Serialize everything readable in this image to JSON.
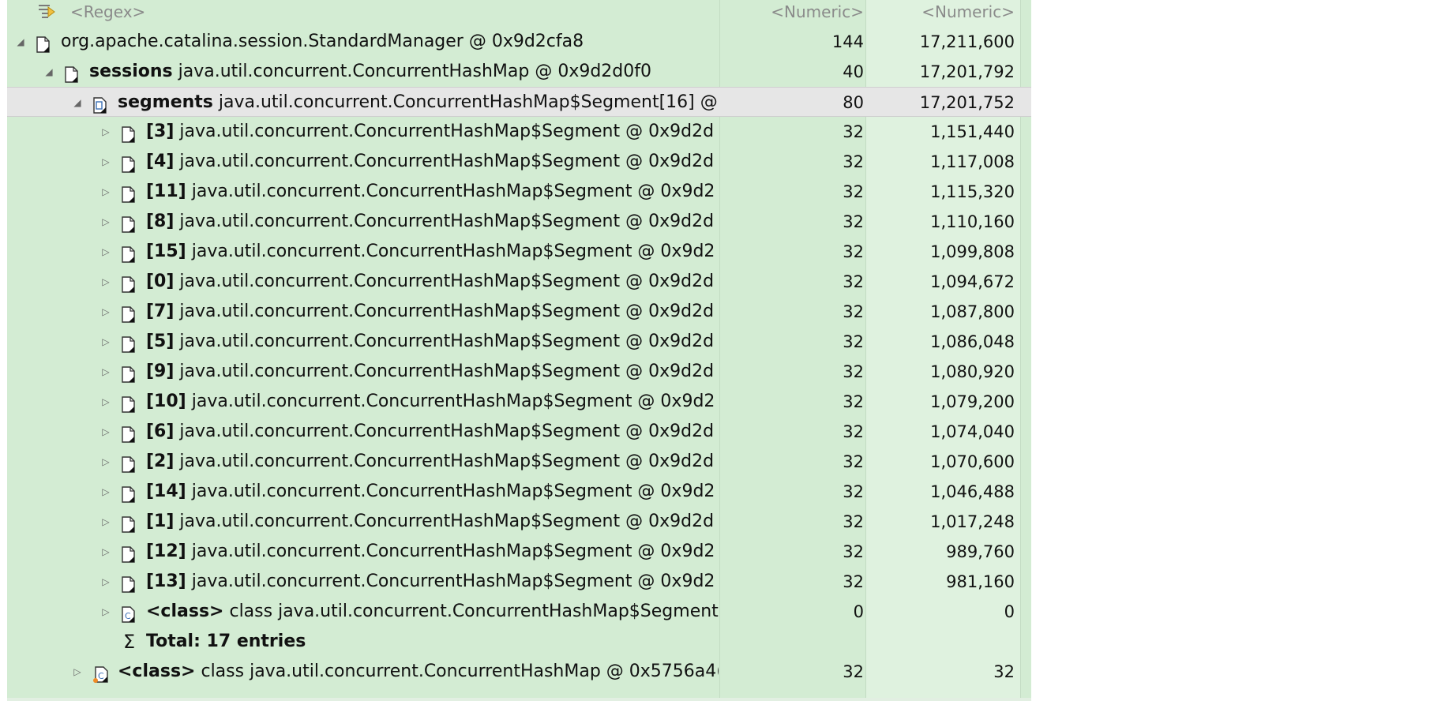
{
  "header": {
    "filter_placeholder": "<Regex>",
    "col1_filter": "<Numeric>",
    "col2_filter": "<Numeric>"
  },
  "rows": [
    {
      "depth": 0,
      "expander": "expanded",
      "icon": "object-icon",
      "bold": "",
      "text": "org.apache.catalina.session.StandardManager @ 0x9d2cfa8",
      "shallow": "144",
      "retained": "17,211,600"
    },
    {
      "depth": 1,
      "expander": "expanded",
      "icon": "object-icon",
      "bold": "sessions",
      "text": " java.util.concurrent.ConcurrentHashMap @ 0x9d2d0f0",
      "shallow": "40",
      "retained": "17,201,792"
    },
    {
      "depth": 2,
      "expander": "expanded",
      "icon": "array-icon",
      "bold": "segments",
      "text": " java.util.concurrent.ConcurrentHashMap$Segment[16] @",
      "shallow": "80",
      "retained": "17,201,752",
      "selected": true
    },
    {
      "depth": 3,
      "expander": "collapsed",
      "icon": "object-icon",
      "bold": "[3]",
      "text": " java.util.concurrent.ConcurrentHashMap$Segment @ 0x9d2d",
      "shallow": "32",
      "retained": "1,151,440"
    },
    {
      "depth": 3,
      "expander": "collapsed",
      "icon": "object-icon",
      "bold": "[4]",
      "text": " java.util.concurrent.ConcurrentHashMap$Segment @ 0x9d2d",
      "shallow": "32",
      "retained": "1,117,008"
    },
    {
      "depth": 3,
      "expander": "collapsed",
      "icon": "object-icon",
      "bold": "[11]",
      "text": " java.util.concurrent.ConcurrentHashMap$Segment @ 0x9d2",
      "shallow": "32",
      "retained": "1,115,320"
    },
    {
      "depth": 3,
      "expander": "collapsed",
      "icon": "object-icon",
      "bold": "[8]",
      "text": " java.util.concurrent.ConcurrentHashMap$Segment @ 0x9d2d",
      "shallow": "32",
      "retained": "1,110,160"
    },
    {
      "depth": 3,
      "expander": "collapsed",
      "icon": "object-icon",
      "bold": "[15]",
      "text": " java.util.concurrent.ConcurrentHashMap$Segment @ 0x9d2",
      "shallow": "32",
      "retained": "1,099,808"
    },
    {
      "depth": 3,
      "expander": "collapsed",
      "icon": "object-icon",
      "bold": "[0]",
      "text": " java.util.concurrent.ConcurrentHashMap$Segment @ 0x9d2d",
      "shallow": "32",
      "retained": "1,094,672"
    },
    {
      "depth": 3,
      "expander": "collapsed",
      "icon": "object-icon",
      "bold": "[7]",
      "text": " java.util.concurrent.ConcurrentHashMap$Segment @ 0x9d2d",
      "shallow": "32",
      "retained": "1,087,800"
    },
    {
      "depth": 3,
      "expander": "collapsed",
      "icon": "object-icon",
      "bold": "[5]",
      "text": " java.util.concurrent.ConcurrentHashMap$Segment @ 0x9d2d",
      "shallow": "32",
      "retained": "1,086,048"
    },
    {
      "depth": 3,
      "expander": "collapsed",
      "icon": "object-icon",
      "bold": "[9]",
      "text": " java.util.concurrent.ConcurrentHashMap$Segment @ 0x9d2d",
      "shallow": "32",
      "retained": "1,080,920"
    },
    {
      "depth": 3,
      "expander": "collapsed",
      "icon": "object-icon",
      "bold": "[10]",
      "text": " java.util.concurrent.ConcurrentHashMap$Segment @ 0x9d2",
      "shallow": "32",
      "retained": "1,079,200"
    },
    {
      "depth": 3,
      "expander": "collapsed",
      "icon": "object-icon",
      "bold": "[6]",
      "text": " java.util.concurrent.ConcurrentHashMap$Segment @ 0x9d2d",
      "shallow": "32",
      "retained": "1,074,040"
    },
    {
      "depth": 3,
      "expander": "collapsed",
      "icon": "object-icon",
      "bold": "[2]",
      "text": " java.util.concurrent.ConcurrentHashMap$Segment @ 0x9d2d",
      "shallow": "32",
      "retained": "1,070,600"
    },
    {
      "depth": 3,
      "expander": "collapsed",
      "icon": "object-icon",
      "bold": "[14]",
      "text": " java.util.concurrent.ConcurrentHashMap$Segment @ 0x9d2",
      "shallow": "32",
      "retained": "1,046,488"
    },
    {
      "depth": 3,
      "expander": "collapsed",
      "icon": "object-icon",
      "bold": "[1]",
      "text": " java.util.concurrent.ConcurrentHashMap$Segment @ 0x9d2d",
      "shallow": "32",
      "retained": "1,017,248"
    },
    {
      "depth": 3,
      "expander": "collapsed",
      "icon": "object-icon",
      "bold": "[12]",
      "text": " java.util.concurrent.ConcurrentHashMap$Segment @ 0x9d2",
      "shallow": "32",
      "retained": "989,760"
    },
    {
      "depth": 3,
      "expander": "collapsed",
      "icon": "object-icon",
      "bold": "[13]",
      "text": " java.util.concurrent.ConcurrentHashMap$Segment @ 0x9d2",
      "shallow": "32",
      "retained": "981,160"
    },
    {
      "depth": 3,
      "expander": "collapsed",
      "icon": "class-icon",
      "bold": "<class>",
      "text": " class java.util.concurrent.ConcurrentHashMap$Segment",
      "shallow": "0",
      "retained": "0"
    },
    {
      "depth": 3,
      "expander": "none",
      "icon": "sigma-icon",
      "bold": "Total: 17 entries",
      "text": "",
      "shallow": "",
      "retained": ""
    },
    {
      "depth": 2,
      "expander": "collapsed",
      "icon": "class-orange-icon",
      "bold": "<class>",
      "text": " class java.util.concurrent.ConcurrentHashMap @ 0x5756a4(",
      "shallow": "32",
      "retained": "32"
    }
  ],
  "colors": {
    "row_bg": "#d3ecd3",
    "retained_col_bg": "#dff2df",
    "selected_bg": "#e6e6e6"
  }
}
